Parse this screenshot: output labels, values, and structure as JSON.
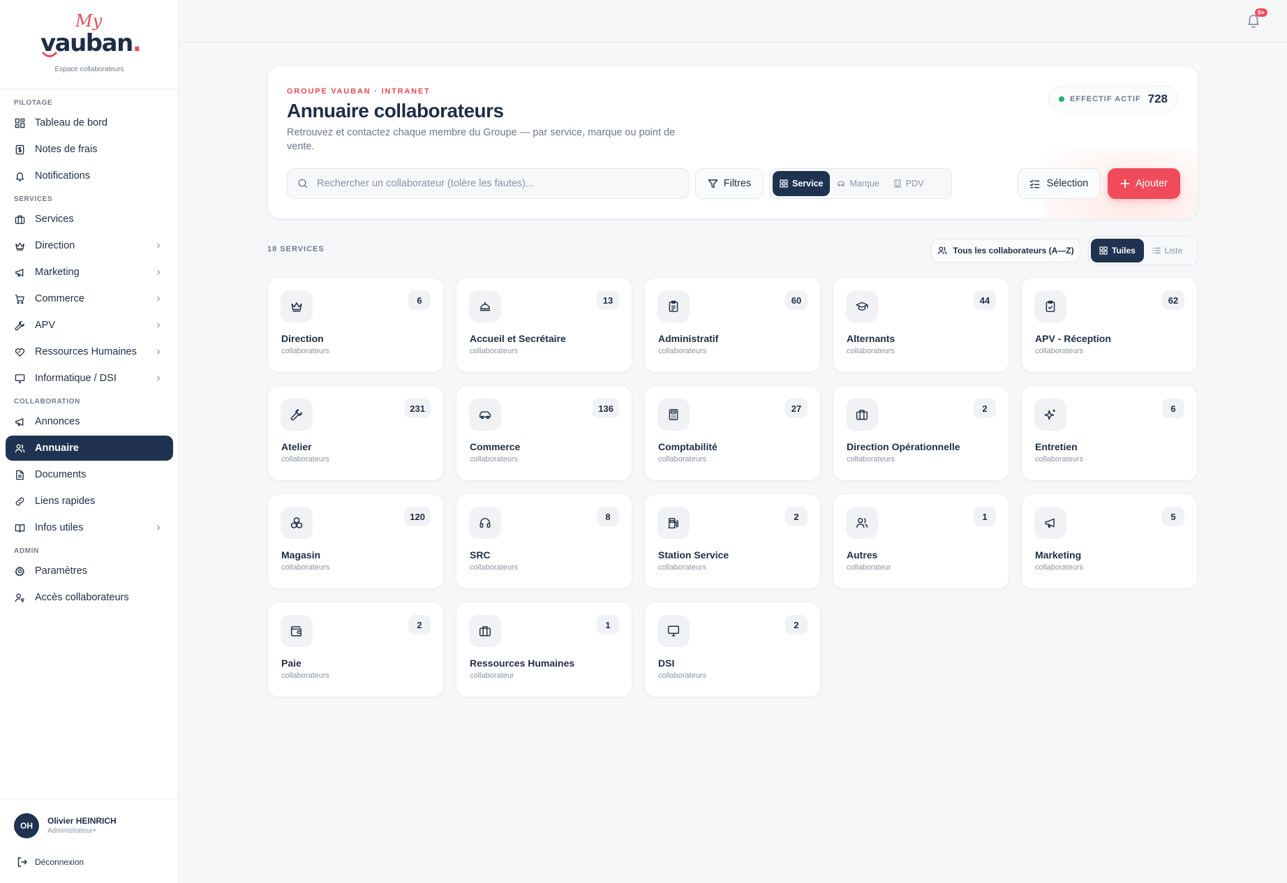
{
  "brand": {
    "logo_my": "My",
    "logo_main": "vauban",
    "logo_dot": ".",
    "tagline": "Espace collaborateurs"
  },
  "sidebar": {
    "sections": [
      {
        "title": "PILOTAGE",
        "items": [
          {
            "label": "Tableau de bord",
            "icon": "dashboard-icon"
          },
          {
            "label": "Notes de frais",
            "icon": "receipt-icon"
          },
          {
            "label": "Notifications",
            "icon": "bell-icon"
          }
        ]
      },
      {
        "title": "SERVICES",
        "items": [
          {
            "label": "Services",
            "icon": "briefcase-icon"
          },
          {
            "label": "Direction",
            "icon": "crown-icon"
          },
          {
            "label": "Marketing",
            "icon": "megaphone-icon"
          },
          {
            "label": "Commerce",
            "icon": "cart-icon"
          },
          {
            "label": "APV",
            "icon": "wrench-icon"
          },
          {
            "label": "Ressources Humaines",
            "icon": "heart-hands-icon"
          },
          {
            "label": "Informatique / DSI",
            "icon": "monitor-icon"
          }
        ]
      },
      {
        "title": "COLLABORATION",
        "items": [
          {
            "label": "Annonces",
            "icon": "megaphone-icon"
          },
          {
            "label": "Annuaire",
            "icon": "users-icon"
          },
          {
            "label": "Documents",
            "icon": "document-icon"
          },
          {
            "label": "Liens rapides",
            "icon": "link-icon"
          },
          {
            "label": "Infos utiles",
            "icon": "book-icon"
          }
        ]
      },
      {
        "title": "ADMIN",
        "items": [
          {
            "label": "Paramètres",
            "icon": "gear-icon"
          },
          {
            "label": "Accès collaborateurs",
            "icon": "user-key-icon"
          }
        ]
      }
    ],
    "user": {
      "initials": "OH",
      "name": "Olivier HEINRICH",
      "role": "Administrateur+"
    },
    "logout_label": "Déconnexion"
  },
  "topbar": {
    "notification_badge": "9+"
  },
  "hero": {
    "eyebrow": "GROUPE VAUBAN · INTRANET",
    "title": "Annuaire collaborateurs",
    "description": "Retrouvez et contactez chaque membre du Groupe — par service, marque ou point de vente.",
    "effectif_label": "EFFECTIF ACTIF",
    "effectif_value": "728",
    "search_placeholder": "Rechercher un collaborateur (tolère les fautes)...",
    "filters_label": "Filtres",
    "group_by": {
      "service": "Service",
      "marque": "Marque",
      "pdv": "PDV"
    },
    "selection_label": "Sélection",
    "add_label": "Ajouter"
  },
  "listing": {
    "count_label": "18 SERVICES",
    "all_button": "Tous les collaborateurs (A—Z)",
    "view_tiles": "Tuiles",
    "view_list": "Liste"
  },
  "services": [
    {
      "name": "Direction",
      "count": "6",
      "unit": "collaborateurs",
      "icon": "crown-icon"
    },
    {
      "name": "Accueil et Secrétaire",
      "count": "13",
      "unit": "collaborateurs",
      "icon": "bell-concierge-icon"
    },
    {
      "name": "Administratif",
      "count": "60",
      "unit": "collaborateurs",
      "icon": "clipboard-icon"
    },
    {
      "name": "Alternants",
      "count": "44",
      "unit": "collaborateurs",
      "icon": "graduation-cap-icon"
    },
    {
      "name": "APV - Réception",
      "count": "62",
      "unit": "collaborateurs",
      "icon": "clipboard-check-icon"
    },
    {
      "name": "Atelier",
      "count": "231",
      "unit": "collaborateurs",
      "icon": "wrench-icon"
    },
    {
      "name": "Commerce",
      "count": "136",
      "unit": "collaborateurs",
      "icon": "car-icon"
    },
    {
      "name": "Comptabilité",
      "count": "27",
      "unit": "collaborateurs",
      "icon": "calculator-icon"
    },
    {
      "name": "Direction Opérationnelle",
      "count": "2",
      "unit": "collaborateurs",
      "icon": "briefcase-icon"
    },
    {
      "name": "Entretien",
      "count": "6",
      "unit": "collaborateurs",
      "icon": "sparkles-icon"
    },
    {
      "name": "Magasin",
      "count": "120",
      "unit": "collaborateurs",
      "icon": "boxes-icon"
    },
    {
      "name": "SRC",
      "count": "8",
      "unit": "collaborateurs",
      "icon": "headset-icon"
    },
    {
      "name": "Station Service",
      "count": "2",
      "unit": "collaborateurs",
      "icon": "fuel-icon"
    },
    {
      "name": "Autres",
      "count": "1",
      "unit": "collaborateur",
      "icon": "users-icon"
    },
    {
      "name": "Marketing",
      "count": "5",
      "unit": "collaborateurs",
      "icon": "megaphone-icon"
    },
    {
      "name": "Paie",
      "count": "2",
      "unit": "collaborateurs",
      "icon": "wallet-icon"
    },
    {
      "name": "Ressources Humaines",
      "count": "1",
      "unit": "collaborateur",
      "icon": "briefcase-icon"
    },
    {
      "name": "DSI",
      "count": "2",
      "unit": "collaborateurs",
      "icon": "monitor-icon"
    }
  ],
  "colors": {
    "navy": "#1f3350",
    "accent_red": "#ef4b5b",
    "status_green": "#22b07a"
  }
}
